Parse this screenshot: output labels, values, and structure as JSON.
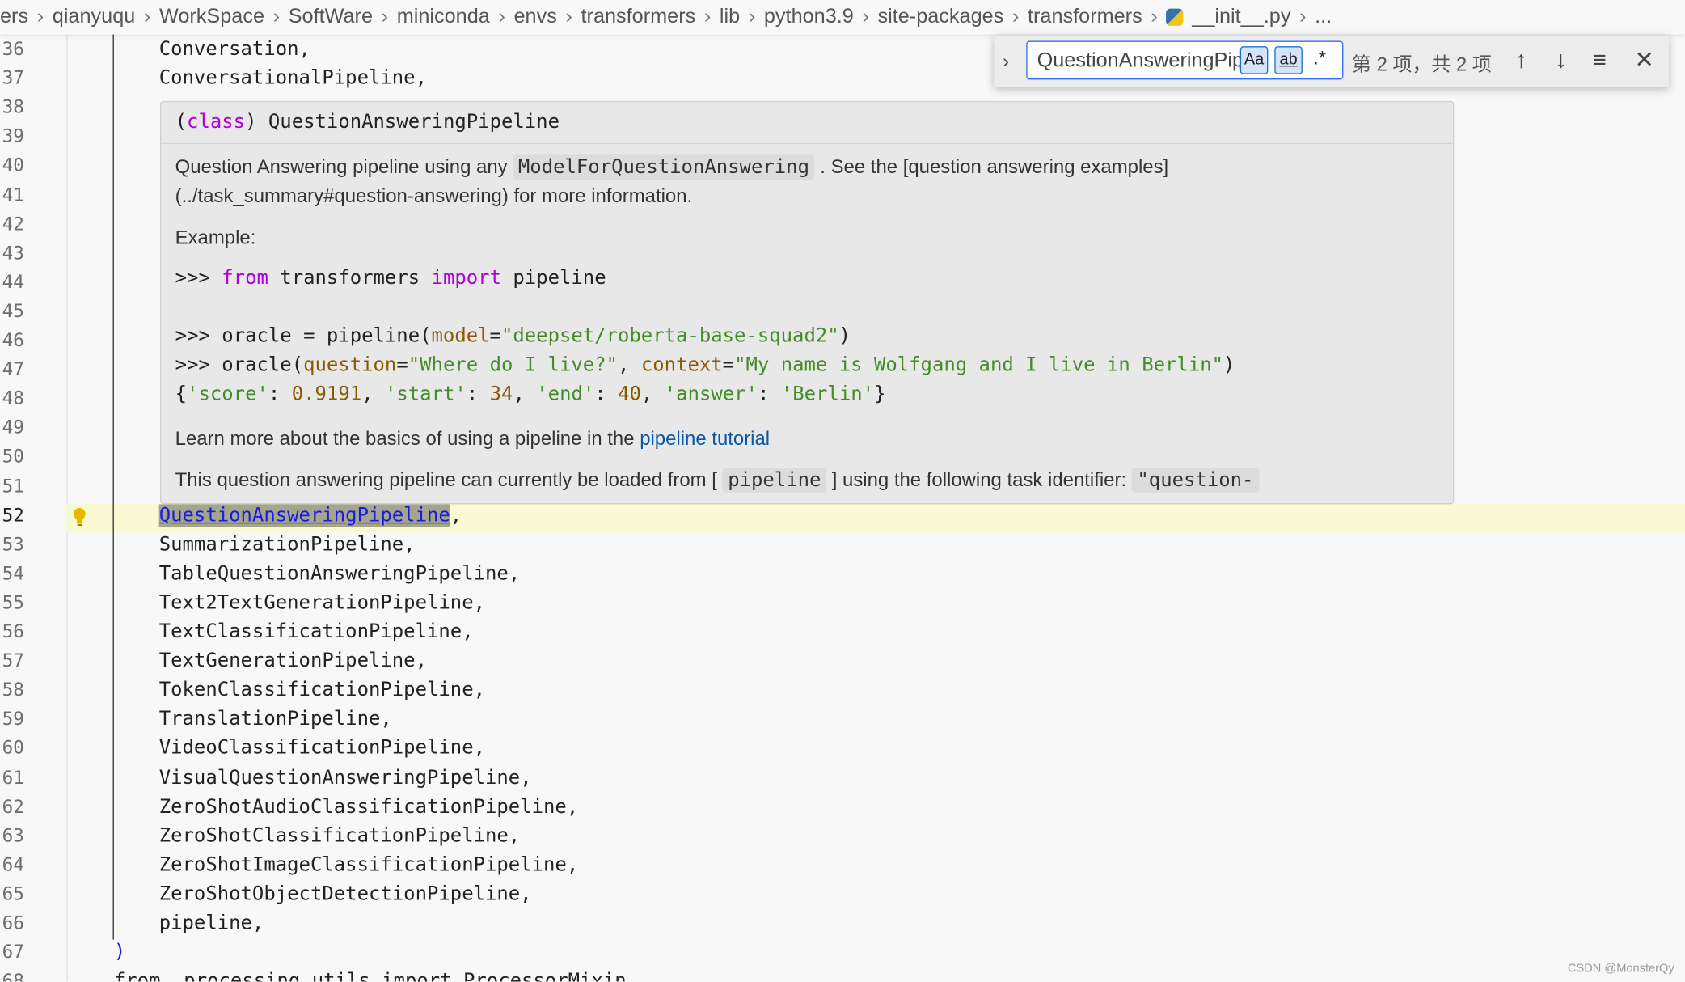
{
  "breadcrumb": [
    "ers",
    "qianyuqu",
    "WorkSpace",
    "SoftWare",
    "miniconda",
    "envs",
    "transformers",
    "lib",
    "python3.9",
    "site-packages",
    "transformers",
    "__init__.py",
    "..."
  ],
  "editor": {
    "lines": [
      {
        "n": "36",
        "text": "Conversation,"
      },
      {
        "n": "37",
        "text": "ConversationalPipeline,"
      },
      {
        "n": "38",
        "text": ""
      },
      {
        "n": "39",
        "text": ""
      },
      {
        "n": "40",
        "text": ""
      },
      {
        "n": "41",
        "text": ""
      },
      {
        "n": "42",
        "text": ""
      },
      {
        "n": "43",
        "text": ""
      },
      {
        "n": "44",
        "text": ""
      },
      {
        "n": "45",
        "text": ""
      },
      {
        "n": "46",
        "text": ""
      },
      {
        "n": "47",
        "text": ""
      },
      {
        "n": "48",
        "text": ""
      },
      {
        "n": "49",
        "text": ""
      },
      {
        "n": "50",
        "text": ""
      },
      {
        "n": "51",
        "text": ""
      },
      {
        "n": "52",
        "text": "QuestionAnsweringPipeline",
        "suffix": ",",
        "current": true
      },
      {
        "n": "53",
        "text": "SummarizationPipeline,"
      },
      {
        "n": "54",
        "text": "TableQuestionAnsweringPipeline,"
      },
      {
        "n": "55",
        "text": "Text2TextGenerationPipeline,"
      },
      {
        "n": "56",
        "text": "TextClassificationPipeline,"
      },
      {
        "n": "57",
        "text": "TextGenerationPipeline,"
      },
      {
        "n": "58",
        "text": "TokenClassificationPipeline,"
      },
      {
        "n": "59",
        "text": "TranslationPipeline,"
      },
      {
        "n": "60",
        "text": "VideoClassificationPipeline,"
      },
      {
        "n": "61",
        "text": "VisualQuestionAnsweringPipeline,"
      },
      {
        "n": "62",
        "text": "ZeroShotAudioClassificationPipeline,"
      },
      {
        "n": "63",
        "text": "ZeroShotClassificationPipeline,"
      },
      {
        "n": "64",
        "text": "ZeroShotImageClassificationPipeline,"
      },
      {
        "n": "65",
        "text": "ZeroShotObjectDetectionPipeline,"
      },
      {
        "n": "66",
        "text": "pipeline,"
      },
      {
        "n": "67",
        "text": ")",
        "indent": "outer"
      },
      {
        "n": "68",
        "text": "from .processing_utils import ProcessorMixin",
        "indent": "outer"
      }
    ]
  },
  "hover": {
    "sig_kw": "class",
    "sig_name": "QuestionAnsweringPipeline",
    "desc_a": "Question Answering pipeline using any ",
    "desc_code": "ModelForQuestionAnswering",
    "desc_b": " . See the [question answering examples]",
    "desc_c": "(../task_summary#question-answering) for more information.",
    "example_label": "Example:",
    "example": [
      [
        {
          "t": ">>> "
        },
        {
          "t": "from",
          "c": "kw"
        },
        {
          "t": " transformers "
        },
        {
          "t": "import",
          "c": "kw"
        },
        {
          "t": " pipeline"
        }
      ],
      [],
      [
        {
          "t": ">>> oracle = pipeline("
        },
        {
          "t": "model",
          "c": "par"
        },
        {
          "t": "="
        },
        {
          "t": "\"deepset/roberta-base-squad2\"",
          "c": "str"
        },
        {
          "t": ")"
        }
      ],
      [
        {
          "t": ">>> oracle("
        },
        {
          "t": "question",
          "c": "par"
        },
        {
          "t": "="
        },
        {
          "t": "\"Where do I live?\"",
          "c": "str"
        },
        {
          "t": ", "
        },
        {
          "t": "context",
          "c": "par"
        },
        {
          "t": "="
        },
        {
          "t": "\"My name is Wolfgang and I live in Berlin\"",
          "c": "str"
        },
        {
          "t": ")"
        }
      ],
      [
        {
          "t": "{"
        },
        {
          "t": "'score'",
          "c": "str"
        },
        {
          "t": ": "
        },
        {
          "t": "0.9191",
          "c": "num"
        },
        {
          "t": ", "
        },
        {
          "t": "'start'",
          "c": "str"
        },
        {
          "t": ": "
        },
        {
          "t": "34",
          "c": "num"
        },
        {
          "t": ", "
        },
        {
          "t": "'end'",
          "c": "str"
        },
        {
          "t": ": "
        },
        {
          "t": "40",
          "c": "num"
        },
        {
          "t": ", "
        },
        {
          "t": "'answer'",
          "c": "str"
        },
        {
          "t": ": "
        },
        {
          "t": "'Berlin'",
          "c": "str"
        },
        {
          "t": "}"
        }
      ]
    ],
    "learn_a": "Learn more about the basics of using a pipeline in the ",
    "learn_link": "pipeline tutorial",
    "task_a": "This question answering pipeline can currently be loaded from [ ",
    "task_code": "pipeline",
    "task_b": " ] using the following task identifier: ",
    "task_id": "\"question-"
  },
  "find": {
    "value": "QuestionAnsweringPipeline",
    "match_case": "Aa",
    "whole_word": "ab",
    "regex": ".*",
    "count": "第 2 项，共 2 项",
    "match_case_on": true,
    "whole_word_on": true
  },
  "watermark": "CSDN @MonsterQy"
}
